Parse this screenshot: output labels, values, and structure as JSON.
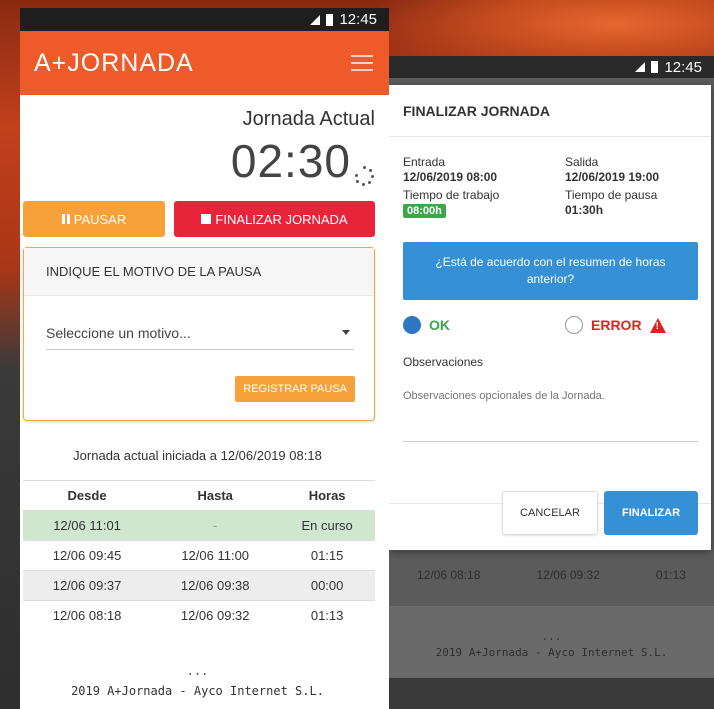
{
  "colors": {
    "accent": "#ef5a2b",
    "pausar": "#f7a13a",
    "finalizar": "#e8243b",
    "primary": "#3590d6",
    "ok": "#3aa84b",
    "error": "#e32121"
  },
  "statusbar": {
    "time": "12:45"
  },
  "app": {
    "title": "A+JORNADA"
  },
  "main": {
    "label": "Jornada Actual",
    "timer": "02:30",
    "pausar_label": "PAUSAR",
    "finalizar_label": "FINALIZAR JORNADA"
  },
  "motivo": {
    "heading": "INDIQUE EL MOTIVO DE LA PAUSA",
    "select_value": "Seleccione un motivo...",
    "registrar_label": "REGISTRAR PAUSA"
  },
  "historial": {
    "iniciada": "Jornada actual iniciada a 12/06/2019 08:18",
    "columns": [
      "Desde",
      "Hasta",
      "Horas"
    ],
    "rows": [
      [
        "12/06 11:01",
        "-",
        "En curso"
      ],
      [
        "12/06 09:45",
        "12/06 11:00",
        "01:15"
      ],
      [
        "12/06 09:37",
        "12/06 09:38",
        "00:00"
      ],
      [
        "12/06 08:18",
        "12/06 09:32",
        "01:13"
      ]
    ]
  },
  "footer": {
    "dots": "...",
    "text": "2019 A+Jornada - Ayco Internet S.L."
  },
  "dialog": {
    "title": "FINALIZAR JORNADA",
    "entrada_label": "Entrada",
    "entrada_value": "12/06/2019 08:00",
    "salida_label": "Salida",
    "salida_value": "12/06/2019 19:00",
    "trabajo_label": "Tiempo de trabajo",
    "trabajo_value": "08:00h",
    "pausa_label": "Tiempo de pausa",
    "pausa_value": "01:30h",
    "question": "¿Está de acuerdo con el resumen de horas anterior?",
    "ok_label": "OK",
    "error_label": "ERROR",
    "obs_label": "Observaciones",
    "obs_placeholder": "Observaciones opcionales de la Jornada.",
    "cancel_label": "CANCELAR",
    "final_label": "FINALIZAR"
  },
  "background_row": [
    "12/06 08:18",
    "12/06 09:32",
    "01:13"
  ]
}
